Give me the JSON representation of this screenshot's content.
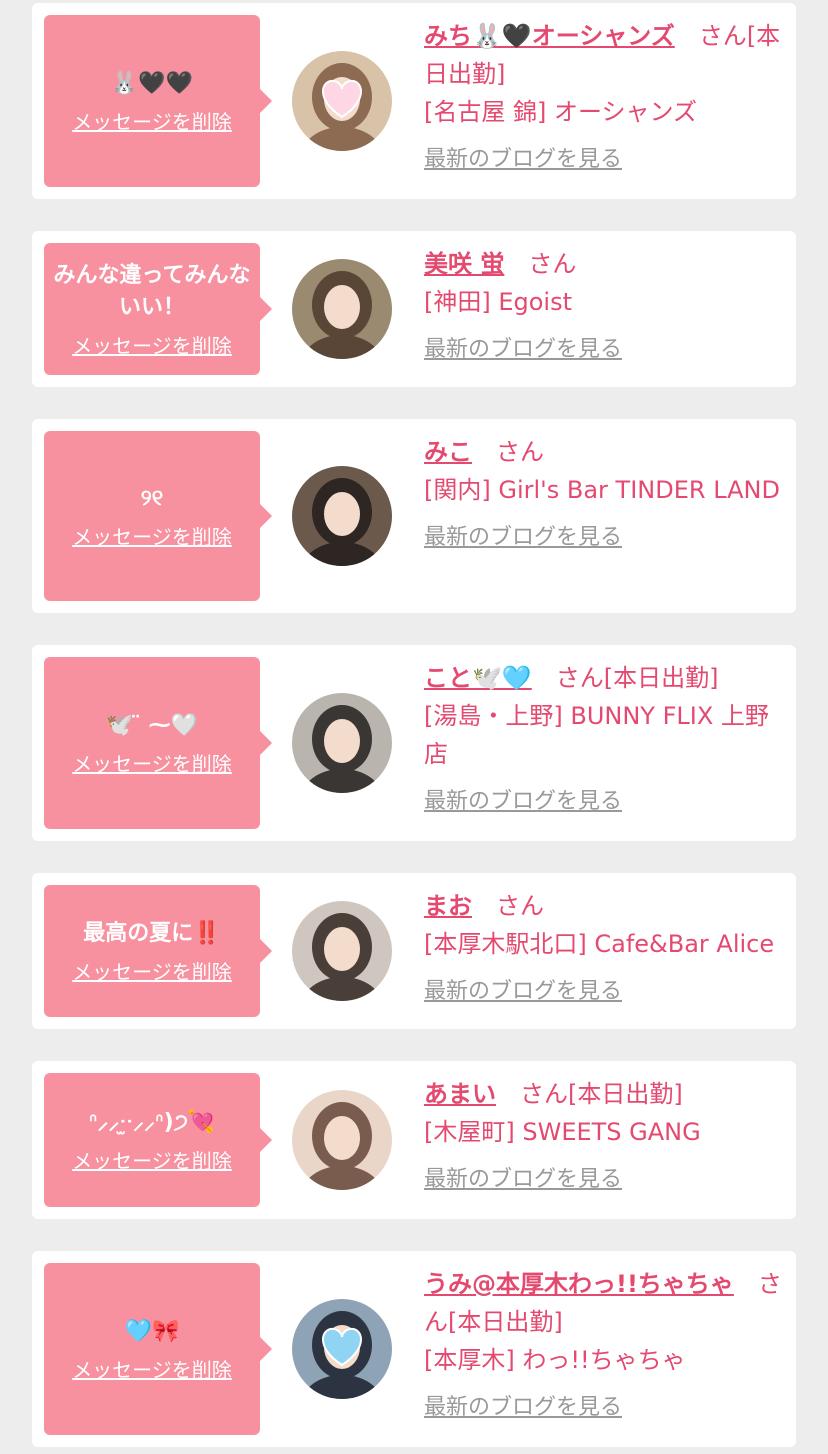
{
  "delete_label": "メッセージを削除",
  "honorific": "さん",
  "blog_link_label": "最新のブログを見る",
  "colors": {
    "background": "#ededed",
    "card": "#ffffff",
    "bubble": "#f7909f",
    "name_text": "#e44a6f",
    "blog_link": "#999999"
  },
  "cards": [
    {
      "message": "🐰🖤🖤",
      "name": "みち🐰🖤オーシャンズ",
      "honorific": "さん",
      "tag": "[本日出勤]",
      "shop": "[名古屋 錦] オーシャンズ",
      "avatar_icon": "avatar-heart-sticker"
    },
    {
      "message": "みんな違ってみんないい！",
      "name": "美咲 蛍",
      "honorific": "さん",
      "tag": "",
      "shop": "[神田] Egoist",
      "avatar_icon": "avatar-doll"
    },
    {
      "message": "୨୧",
      "name": "みこ",
      "honorific": "さん",
      "tag": "",
      "shop": "[関内] Girl's Bar TINDER LAND",
      "avatar_icon": "avatar-photo"
    },
    {
      "message": "🕊️ ̈ ⁓🤍",
      "name": "こと🕊️🩵",
      "honorific": "さん",
      "tag": "[本日出勤]",
      "shop": "[湯島・上野] BUNNY FLIX 上野店",
      "avatar_icon": "avatar-photo"
    },
    {
      "message": "最高の夏に‼️",
      "name": "まお",
      "honorific": "さん",
      "tag": "",
      "shop": "[本厚木駅北口] Cafe&Bar Alice",
      "avatar_icon": "avatar-photo"
    },
    {
      "message": "ᐢ⸝⸝ᐧ̫ᐧ⸝⸝ᐢ)੭💘",
      "name": "あまい",
      "honorific": "さん",
      "tag": "[本日出勤]",
      "shop": "[木屋町] SWEETS GANG",
      "avatar_icon": "avatar-photo"
    },
    {
      "message": "🩵🎀",
      "name": "うみ@本厚木わっ!!ちゃちゃ",
      "honorific": "さん",
      "tag": "[本日出勤]",
      "shop": "[本厚木] わっ!!ちゃちゃ",
      "avatar_icon": "avatar-heart-sticker"
    }
  ]
}
